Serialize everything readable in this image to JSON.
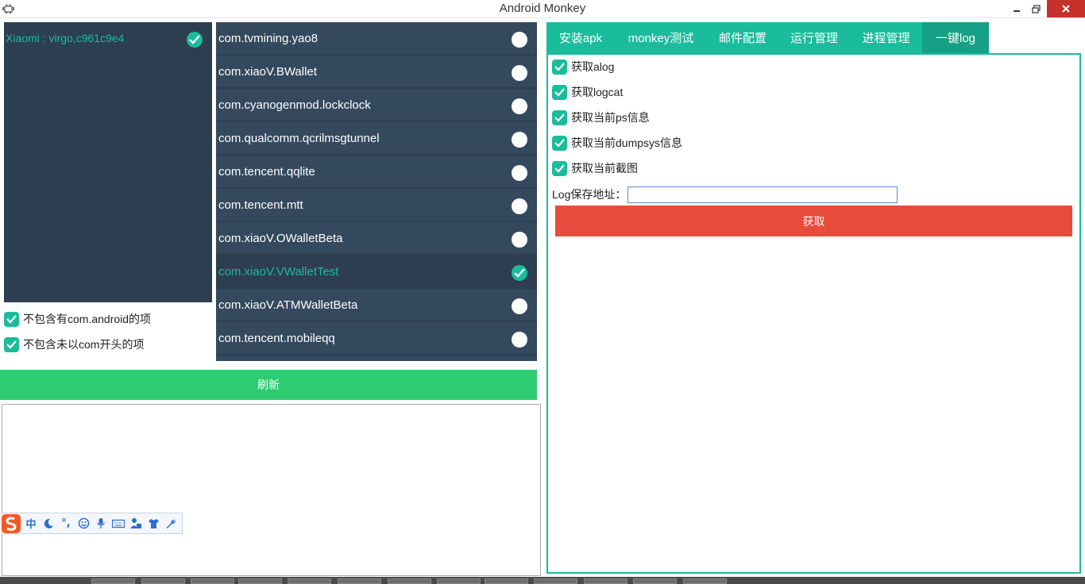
{
  "window": {
    "title": "Android Monkey",
    "icons": {
      "app": "android-icon",
      "minimize": "minimize-icon",
      "maximize": "restore-icon",
      "close": "close-icon"
    }
  },
  "devices": {
    "items": [
      {
        "label": "Xiaomi : virgo,c961c9e4",
        "checked": true
      }
    ]
  },
  "filters": [
    {
      "label": "不包含有com.android的项",
      "checked": true
    },
    {
      "label": "不包含未以com开头的项",
      "checked": true
    }
  ],
  "packages": [
    {
      "label": "com.tvmining.yao8",
      "checked": false
    },
    {
      "label": "com.xiaoV.BWallet",
      "checked": false
    },
    {
      "label": "com.cyanogenmod.lockclock",
      "checked": false
    },
    {
      "label": "com.qualcomm.qcrilmsgtunnel",
      "checked": false
    },
    {
      "label": "com.tencent.qqlite",
      "checked": false
    },
    {
      "label": "com.tencent.mtt",
      "checked": false
    },
    {
      "label": "com.xiaoV.OWalletBeta",
      "checked": false
    },
    {
      "label": "com.xiaoV.VWalletTest",
      "checked": true
    },
    {
      "label": "com.xiaoV.ATMWalletBeta",
      "checked": false
    },
    {
      "label": "com.tencent.mobileqq",
      "checked": false
    }
  ],
  "refresh_label": "刷新",
  "tabs": [
    {
      "label": "安装apk",
      "active": false
    },
    {
      "label": "monkey测试",
      "active": false
    },
    {
      "label": "邮件配置",
      "active": false
    },
    {
      "label": "运行管理",
      "active": false
    },
    {
      "label": "进程管理",
      "active": false
    },
    {
      "label": "一键log",
      "active": true
    }
  ],
  "log_options": [
    {
      "label": "获取alog",
      "checked": true
    },
    {
      "label": "获取logcat",
      "checked": true
    },
    {
      "label": "获取当前ps信息",
      "checked": true
    },
    {
      "label": "获取当前dumpsys信息",
      "checked": true
    },
    {
      "label": "获取当前截图",
      "checked": true
    }
  ],
  "log_path": {
    "label": "Log保存地址：",
    "value": ""
  },
  "fetch_label": "获取",
  "ime_toolbar": {
    "logo": "sogou-logo-icon",
    "items": [
      "中",
      "moon-icon",
      "°,",
      "smiley-icon",
      "microphone-icon",
      "keyboard-icon",
      "user-icon",
      "shirt-icon",
      "wrench-icon"
    ],
    "mode_label": "中",
    "punct_label": "°,"
  },
  "colors": {
    "dark_panel": "#2c3e50",
    "list_panel": "#34495e",
    "accent": "#1abc9c",
    "accent_dark": "#16a085",
    "refresh": "#2ecc71",
    "fetch": "#e74c3c"
  }
}
